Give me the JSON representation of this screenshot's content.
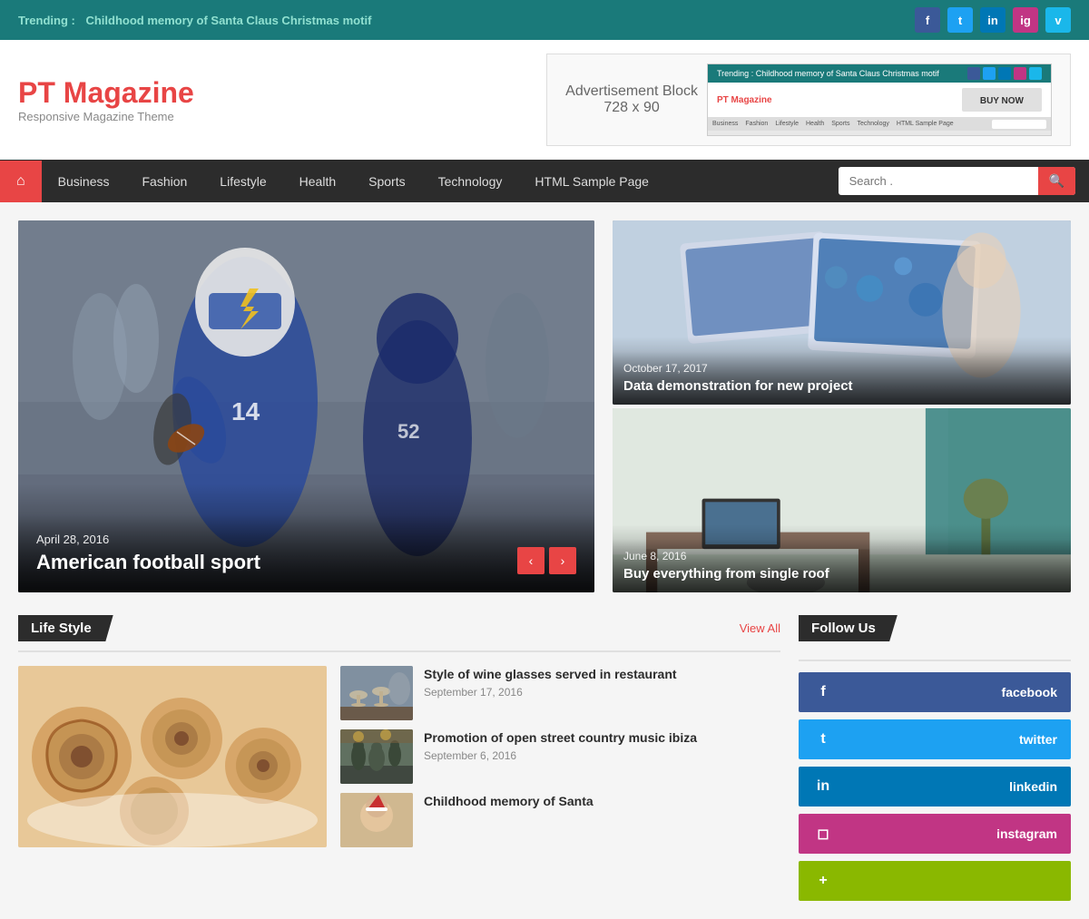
{
  "trending": {
    "label": "Trending :",
    "text": "Childhood memory of Santa Claus Christmas motif"
  },
  "social_icons": [
    "f",
    "t",
    "in",
    "ig",
    "v"
  ],
  "logo": {
    "title": "PT Magazine",
    "subtitle": "Responsive Magazine Theme"
  },
  "ad": {
    "line1": "Advertisement Block",
    "line2": "728 x 90"
  },
  "nav": {
    "home_icon": "⌂",
    "links": [
      "Business",
      "Fashion",
      "Lifestyle",
      "Health",
      "Sports",
      "Technology",
      "HTML Sample Page"
    ],
    "search_placeholder": "Search .",
    "search_icon": "🔍"
  },
  "hero": {
    "date": "April 28, 2016",
    "title": "American football sport",
    "prev": "‹",
    "next": "›"
  },
  "side_articles": [
    {
      "date": "October 17, 2017",
      "title": "Data demonstration for new project"
    },
    {
      "date": "June 8, 2016",
      "title": "Buy everything from single roof"
    }
  ],
  "lifestyle": {
    "section_title": "Life Style",
    "view_all": "View All",
    "articles": [
      {
        "title": "Style of wine glasses served in restaurant",
        "date": "September 17, 2016"
      },
      {
        "title": "Promotion of open street country music ibiza",
        "date": "September 6, 2016"
      },
      {
        "title": "Childhood memory of Santa",
        "date": ""
      }
    ]
  },
  "follow": {
    "title": "Follow Us",
    "platforms": [
      "facebook",
      "twitter",
      "linkedin",
      "instagram"
    ]
  }
}
